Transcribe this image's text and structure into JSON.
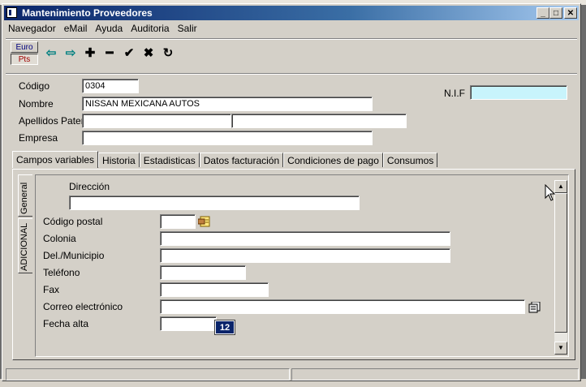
{
  "window": {
    "title": "Mantenimiento Proveedores",
    "minimize_label": "_",
    "maximize_label": "□",
    "close_label": "✕"
  },
  "menu": [
    "Navegador",
    "eMail",
    "Ayuda",
    "Auditoria",
    "Salir"
  ],
  "currency": {
    "euro_label": "Euro",
    "pts_label": "Pts",
    "selected": "Pts"
  },
  "toolbar": {
    "icons": [
      "arrow-left-icon",
      "arrow-right-icon",
      "plus-icon",
      "minus-icon",
      "check-icon",
      "cross-icon",
      "refresh-icon"
    ],
    "glyphs": [
      "⇦",
      "⇨",
      "✚",
      "━",
      "✔",
      "✖",
      "↻"
    ]
  },
  "header_form": {
    "codigo_label": "Código",
    "codigo_value": "0304",
    "nombre_label": "Nombre",
    "nombre_value": "NISSAN MEXICANA AUTOS",
    "apellidos_label": "Apellidos Paterno",
    "apellido1_value": "",
    "apellido2_value": "",
    "empresa_label": "Empresa",
    "empresa_value": "",
    "nif_label": "N.I.F",
    "nif_value": ""
  },
  "tabs": [
    {
      "label": "Campos variables",
      "active": true
    },
    {
      "label": "Historia",
      "active": false
    },
    {
      "label": "Estadisticas",
      "active": false
    },
    {
      "label": "Datos facturación",
      "active": false
    },
    {
      "label": "Condiciones de pago",
      "active": false
    },
    {
      "label": "Consumos",
      "active": false
    }
  ],
  "side_tabs": [
    {
      "label": "General",
      "active": true
    },
    {
      "label": "ADICIONAL",
      "active": false
    }
  ],
  "general_form": {
    "direccion_label": "Dirección",
    "direccion_value": "",
    "codigo_postal_label": "Código postal",
    "codigo_postal_value": "",
    "colonia_label": "Colonia",
    "colonia_value": "",
    "delegacion_label": "Del./Municipio",
    "delegacion_value": "",
    "telefono_label": "Teléfono",
    "telefono_value": "",
    "fax_label": "Fax",
    "fax_value": "",
    "correo_label": "Correo electrónico",
    "correo_value": "",
    "fecha_alta_label": "Fecha alta",
    "fecha_alta_value": "",
    "calendar_label": "12"
  },
  "status": {
    "panel1": "",
    "panel2": ""
  },
  "colors": {
    "titlebar_start": "#0a246a",
    "titlebar_end": "#a6caf0",
    "nif_field": "#c8f4fc",
    "window_bg": "#d4d0c8"
  }
}
